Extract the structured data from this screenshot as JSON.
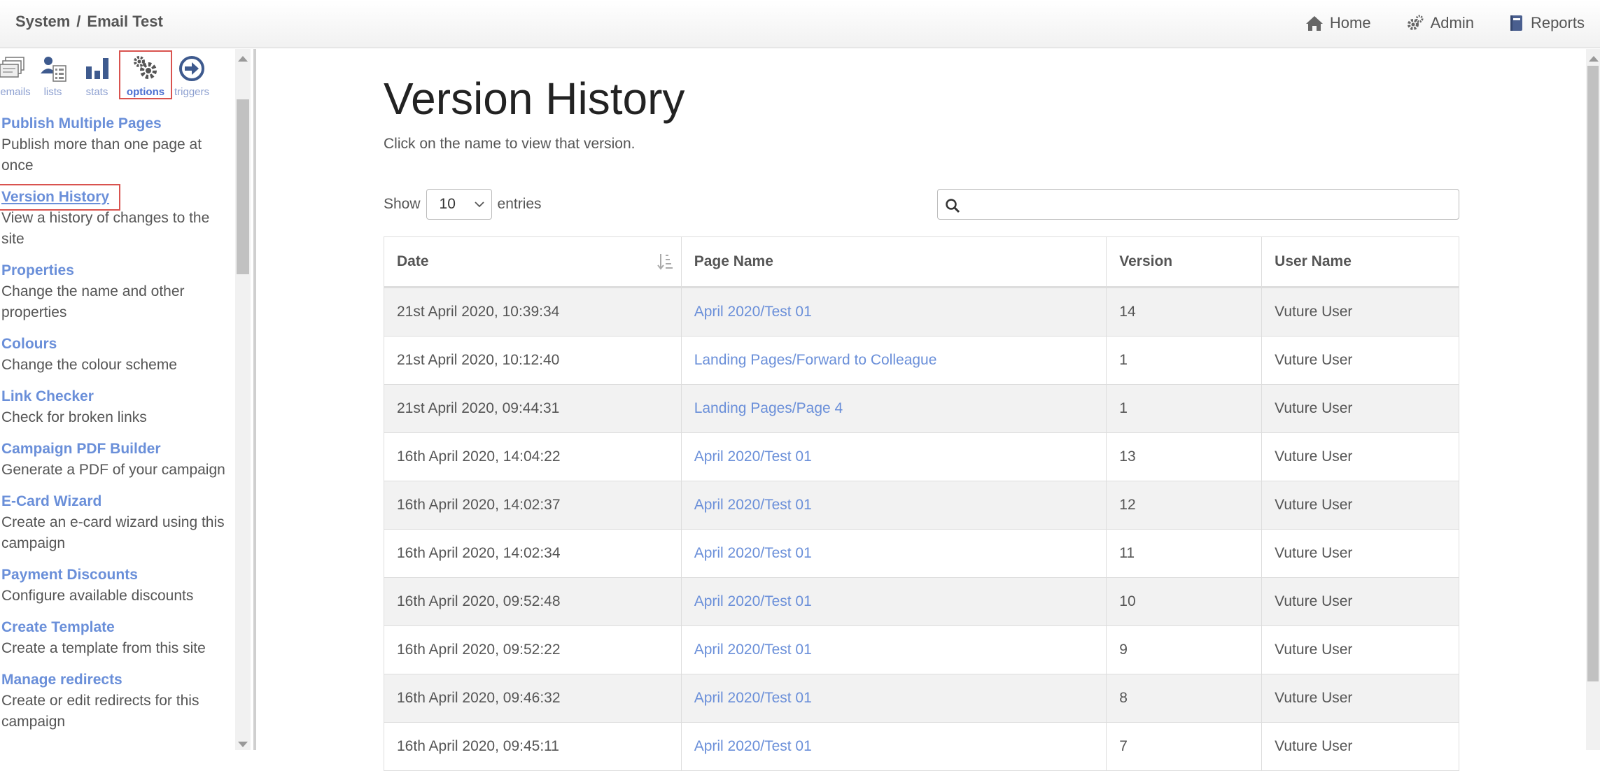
{
  "breadcrumb": {
    "section": "System",
    "separator": "/",
    "page": "Email Test"
  },
  "topnav": [
    {
      "label": "Home",
      "icon": "home-icon"
    },
    {
      "label": "Admin",
      "icon": "gears-icon"
    },
    {
      "label": "Reports",
      "icon": "book-icon"
    }
  ],
  "sidebar": {
    "tabs": [
      {
        "label": "emails",
        "icon": "emails-icon"
      },
      {
        "label": "lists",
        "icon": "lists-icon"
      },
      {
        "label": "stats",
        "icon": "stats-icon"
      },
      {
        "label": "options",
        "icon": "gears-icon",
        "active": true
      },
      {
        "label": "triggers",
        "icon": "arrow-circle-icon"
      }
    ],
    "items": [
      {
        "title": "Publish Multiple Pages",
        "desc": "Publish more than one page at once"
      },
      {
        "title": "Version History",
        "desc": "View a history of changes to the site",
        "active": true
      },
      {
        "title": "Properties",
        "desc": "Change the name and other properties"
      },
      {
        "title": "Colours",
        "desc": "Change the colour scheme"
      },
      {
        "title": "Link Checker",
        "desc": "Check for broken links"
      },
      {
        "title": "Campaign PDF Builder",
        "desc": "Generate a PDF of your campaign"
      },
      {
        "title": "E-Card Wizard",
        "desc": "Create an e-card wizard using this campaign"
      },
      {
        "title": "Payment Discounts",
        "desc": "Configure available discounts"
      },
      {
        "title": "Create Template",
        "desc": "Create a template from this site"
      },
      {
        "title": "Manage redirects",
        "desc": "Create or edit redirects for this campaign"
      }
    ]
  },
  "main": {
    "title": "Version History",
    "subtitle": "Click on the name to view that version.",
    "show_label": "Show",
    "entries_value": "10",
    "entries_label": "entries",
    "search_value": "",
    "columns": [
      "Date",
      "Page Name",
      "Version",
      "User Name"
    ],
    "rows": [
      {
        "date": "21st April 2020, 10:39:34",
        "page": "April 2020/Test 01",
        "version": "14",
        "user": "Vuture User"
      },
      {
        "date": "21st April 2020, 10:12:40",
        "page": "Landing Pages/Forward to Colleague",
        "version": "1",
        "user": "Vuture User"
      },
      {
        "date": "21st April 2020, 09:44:31",
        "page": "Landing Pages/Page 4",
        "version": "1",
        "user": "Vuture User"
      },
      {
        "date": "16th April 2020, 14:04:22",
        "page": "April 2020/Test 01",
        "version": "13",
        "user": "Vuture User"
      },
      {
        "date": "16th April 2020, 14:02:37",
        "page": "April 2020/Test 01",
        "version": "12",
        "user": "Vuture User"
      },
      {
        "date": "16th April 2020, 14:02:34",
        "page": "April 2020/Test 01",
        "version": "11",
        "user": "Vuture User"
      },
      {
        "date": "16th April 2020, 09:52:48",
        "page": "April 2020/Test 01",
        "version": "10",
        "user": "Vuture User"
      },
      {
        "date": "16th April 2020, 09:52:22",
        "page": "April 2020/Test 01",
        "version": "9",
        "user": "Vuture User"
      },
      {
        "date": "16th April 2020, 09:46:32",
        "page": "April 2020/Test 01",
        "version": "8",
        "user": "Vuture User"
      },
      {
        "date": "16th April 2020, 09:45:11",
        "page": "April 2020/Test 01",
        "version": "7",
        "user": "Vuture User"
      }
    ]
  },
  "colors": {
    "link": "#6a8fd9",
    "highlight": "#d9534f",
    "row_alt": "#f2f2f2"
  }
}
